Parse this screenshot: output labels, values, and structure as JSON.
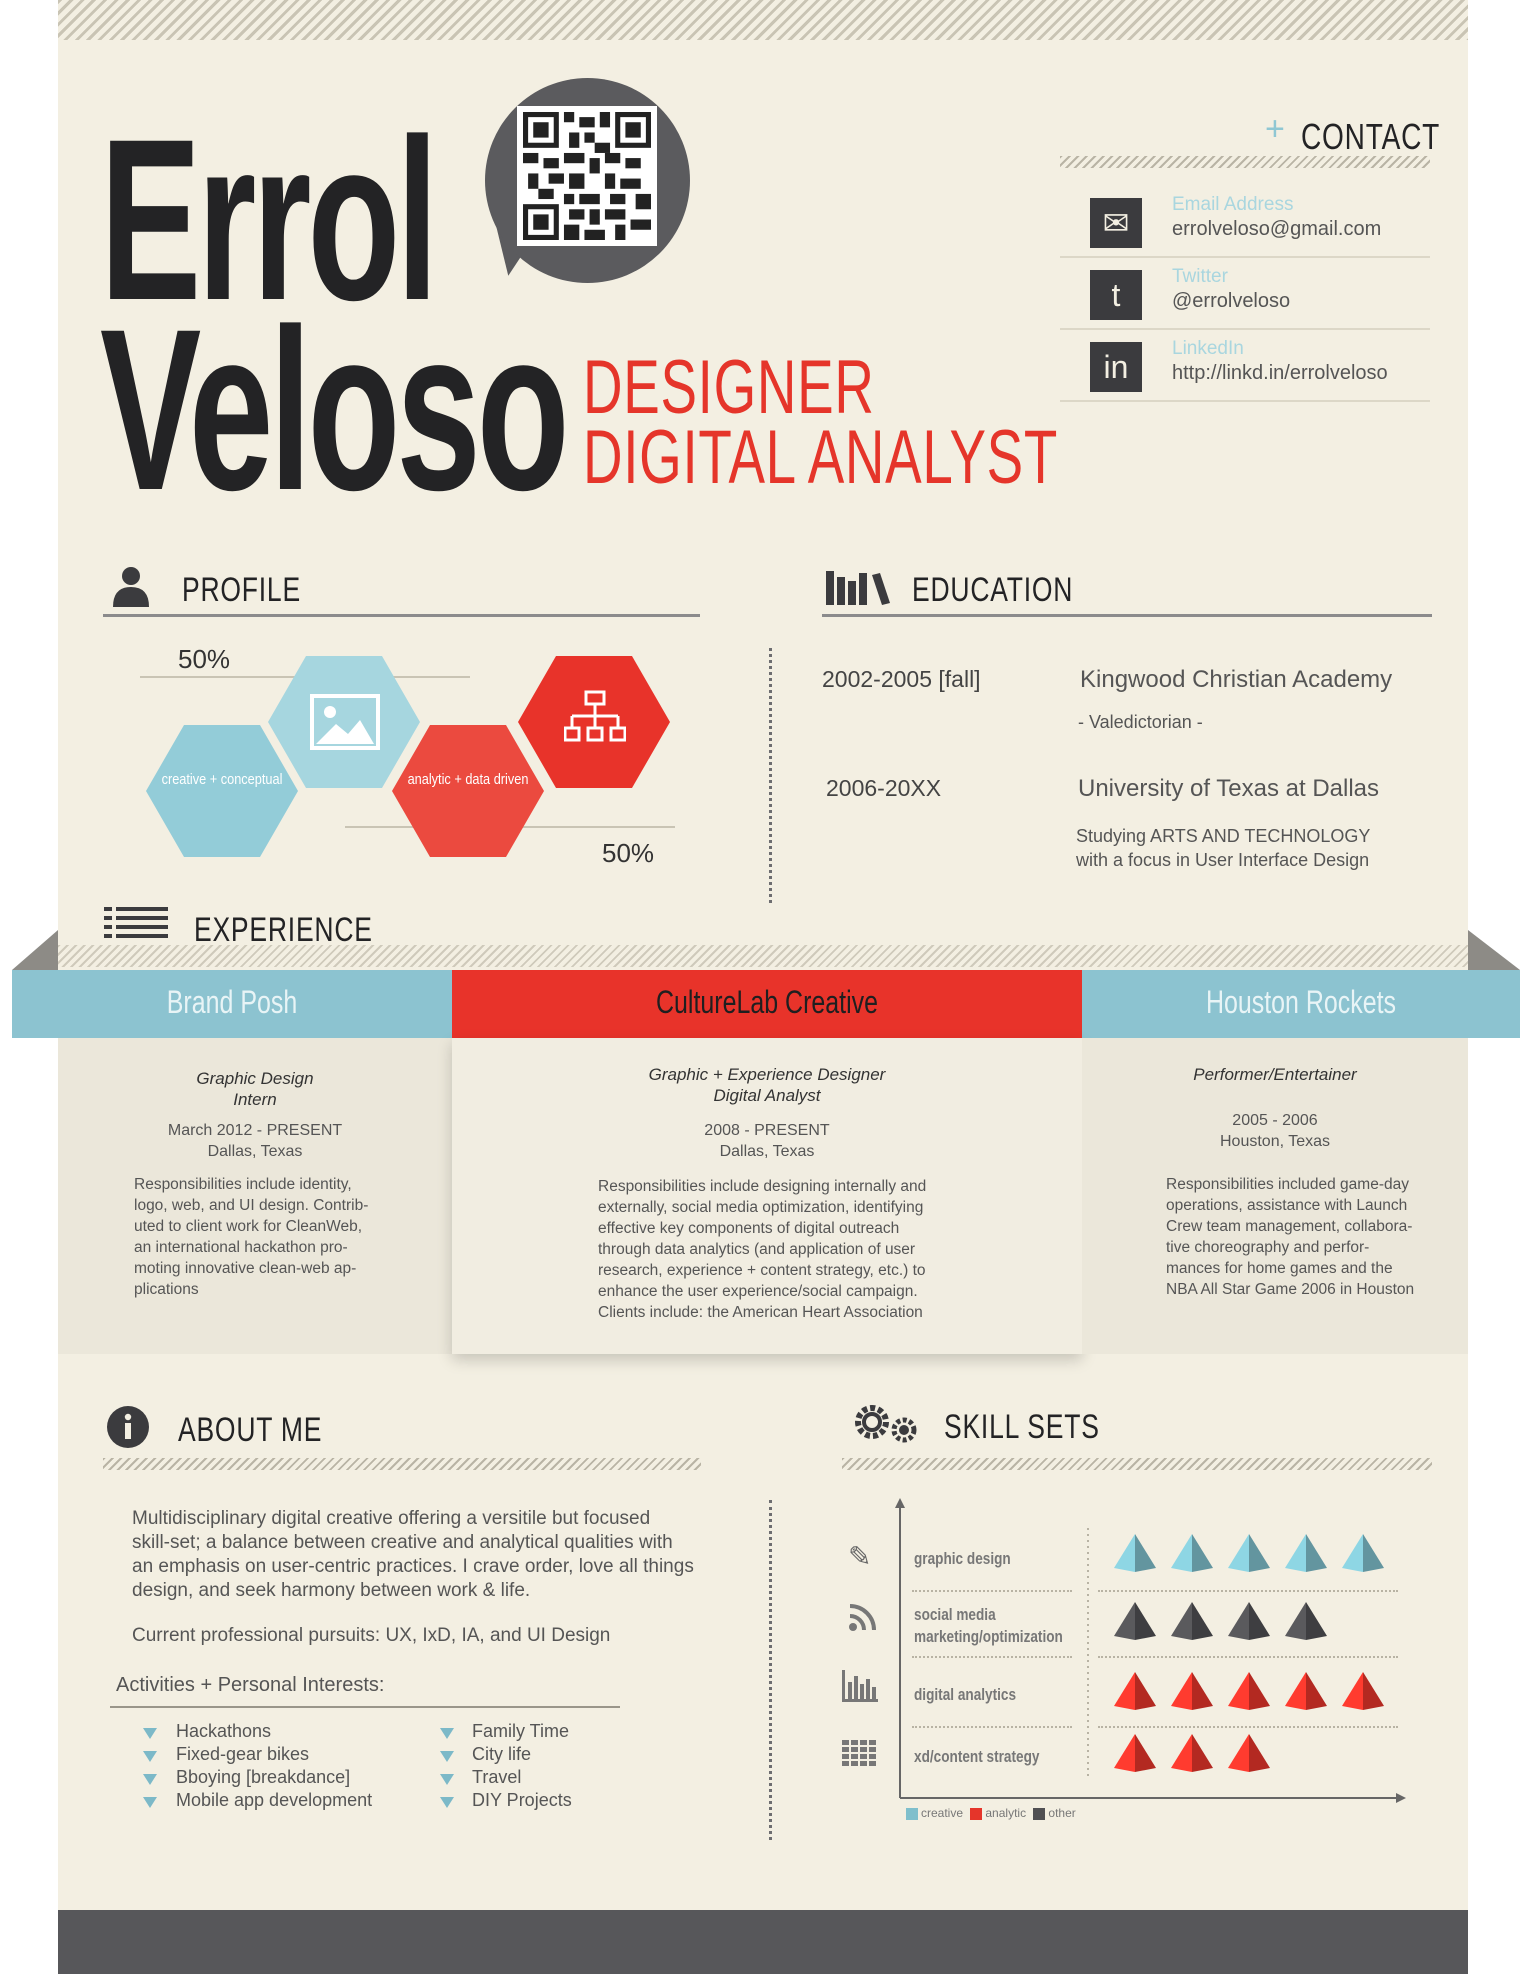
{
  "header": {
    "first_name": "Errol",
    "last_name": "Veloso",
    "role_1": "DESIGNER",
    "role_2": "DIGITAL ANALYST"
  },
  "contact": {
    "heading": "CONTACT",
    "items": [
      {
        "label": "Email Address",
        "value": "errolveloso@gmail.com",
        "icon": "envelope-icon"
      },
      {
        "label": "Twitter",
        "value": "@errolveloso",
        "icon": "twitter-icon"
      },
      {
        "label": "LinkedIn",
        "value": "http://linkd.in/errolveloso",
        "icon": "linkedin-icon"
      }
    ]
  },
  "profile": {
    "heading": "PROFILE",
    "percent_top": "50%",
    "percent_bottom": "50%",
    "hex_creative": "creative + conceptual",
    "hex_analytic": "analytic + data driven"
  },
  "education": {
    "heading": "EDUCATION",
    "entries": [
      {
        "years": "2002-2005 [fall]",
        "school": "Kingwood Christian Academy",
        "detail": "- Valedictorian -"
      },
      {
        "years": "2006-20XX",
        "school": "University of Texas at Dallas",
        "detail_1": "Studying ARTS AND TECHNOLOGY",
        "detail_2": "with a focus in User Interface Design"
      }
    ]
  },
  "experience": {
    "heading": "EXPERIENCE",
    "jobs": [
      {
        "company": "Brand Posh",
        "role_1": "Graphic Design",
        "role_2": "Intern",
        "dates": "March 2012 - PRESENT",
        "location": "Dallas, Texas",
        "desc": [
          "Responsibilities include identity,",
          "logo, web, and UI design. Contrib-",
          "uted to client work for CleanWeb,",
          "an international hackathon pro-",
          "moting innovative clean-web ap-",
          "plications"
        ]
      },
      {
        "company": "CultureLab Creative",
        "role_1": "Graphic + Experience Designer",
        "role_2": "Digital Analyst",
        "dates": "2008 - PRESENT",
        "location": "Dallas, Texas",
        "desc": [
          "Responsibilities include designing internally and",
          "externally, social media optimization, identifying",
          "effective key components of digital outreach",
          "through data analytics (and application of user",
          "research, experience + content strategy, etc.) to",
          "enhance the user experience/social campaign.",
          "Clients include: the American Heart Association"
        ]
      },
      {
        "company": "Houston Rockets",
        "role_1": "Performer/Entertainer",
        "dates": "2005 - 2006",
        "location": "Houston, Texas",
        "desc": [
          "Responsibilities included game-day",
          "operations, assistance with Launch",
          "Crew team management, collabora-",
          "tive choreography and perfor-",
          "mances for home games and the",
          "NBA All Star Game 2006 in Houston"
        ]
      }
    ]
  },
  "about": {
    "heading": "ABOUT ME",
    "paragraph": [
      "Multidisciplinary digital creative offering a versitile but focused",
      "skill-set; a balance between creative and analytical qualities with",
      "an emphasis on user-centric practices. I crave order, love all things",
      "design, and seek harmony between work & life."
    ],
    "pursuits": "Current professional pursuits: UX, IxD, IA, and UI Design",
    "activities_heading": "Activities + Personal Interests:",
    "activities_left": [
      "Hackathons",
      "Fixed-gear bikes",
      "Bboying [breakdance]",
      "Mobile app development"
    ],
    "activities_right": [
      "Family Time",
      "City life",
      "Travel",
      "DIY Projects"
    ]
  },
  "skills": {
    "heading": "SKILL SETS",
    "rows": [
      {
        "label_1": "graphic design",
        "label_2": "",
        "count": 5,
        "color": "#7fbfcc",
        "icon": "pencil-icon"
      },
      {
        "label_1": "social media",
        "label_2": "marketing/optimization",
        "count": 4,
        "color": "#505053",
        "icon": "rss-icon"
      },
      {
        "label_1": "digital analytics",
        "label_2": "",
        "count": 5,
        "color": "#e5352a",
        "icon": "bar-chart-icon"
      },
      {
        "label_1": "xd/content strategy",
        "label_2": "",
        "count": 3,
        "color": "#e5352a",
        "icon": "grid-icon"
      }
    ],
    "legend": [
      "creative",
      "analytic",
      "other"
    ],
    "legend_colors": [
      "#7fbfcc",
      "#e5352a",
      "#505053"
    ]
  }
}
